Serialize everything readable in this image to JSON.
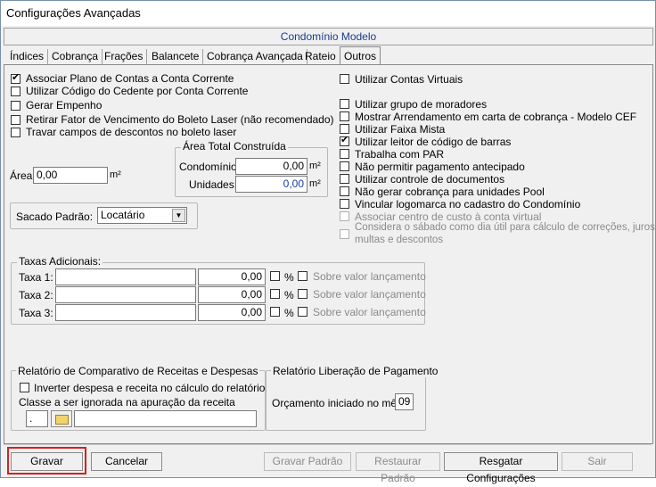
{
  "window": {
    "title": "Configurações Avançadas"
  },
  "header": {
    "title": "Condomínio Modelo"
  },
  "tabs": [
    "Índices",
    "Cobrança",
    "Frações",
    "Balancete",
    "Cobrança Avançada",
    "Rateio",
    "Outros"
  ],
  "active_tab": "Outros",
  "left_options": [
    {
      "label": "Associar Plano de Contas a Conta Corrente",
      "checked": true
    },
    {
      "label": "Utilizar Código do Cedente por Conta Corrente",
      "checked": false
    },
    {
      "label": "Gerar Empenho",
      "checked": false
    },
    {
      "label": "Retirar Fator de Vencimento do Boleto Laser (não recomendado)",
      "checked": false
    },
    {
      "label": "Travar campos de descontos no boleto laser",
      "checked": false
    }
  ],
  "area": {
    "label": "Área:",
    "value": "0,00",
    "unit": "m²"
  },
  "area_total": {
    "title": "Área Total Construída",
    "condominio_label": "Condomínio:",
    "condominio_value": "0,00",
    "unidades_label": "Unidades:",
    "unidades_value": "0,00",
    "unit": "m²"
  },
  "sacado": {
    "label": "Sacado Padrão:",
    "value": "Locatário"
  },
  "right_options": [
    {
      "label": "Utilizar Contas Virtuais",
      "checked": false,
      "disabled": false
    },
    {
      "label": "Utilizar grupo de moradores",
      "checked": false,
      "disabled": false
    },
    {
      "label": "Mostrar Arrendamento em carta de cobrança - Modelo CEF",
      "checked": false,
      "disabled": false
    },
    {
      "label": "Utilizar Faixa Mista",
      "checked": false,
      "disabled": false
    },
    {
      "label": "Utilizar leitor de código de barras",
      "checked": true,
      "disabled": false
    },
    {
      "label": "Trabalha com PAR",
      "checked": false,
      "disabled": false
    },
    {
      "label": "Não permitir pagamento antecipado",
      "checked": false,
      "disabled": false
    },
    {
      "label": "Utilizar controle de documentos",
      "checked": false,
      "disabled": false
    },
    {
      "label": "Não gerar cobrança para unidades Pool",
      "checked": false,
      "disabled": false
    },
    {
      "label": "Vincular logomarca no cadastro do Condomínio",
      "checked": false,
      "disabled": false
    },
    {
      "label": "Associar centro de custo à conta virtual",
      "checked": false,
      "disabled": true
    },
    {
      "label_line1": "Considera o sábado como dia útil para cálculo de correções, juros,",
      "label_line2": "multas e descontos",
      "checked": false,
      "disabled": true
    }
  ],
  "taxas": {
    "title": "Taxas Adicionais:",
    "rows": [
      {
        "label": "Taxa 1:",
        "name": "",
        "value": "0,00",
        "pct": "%",
        "sobre": "Sobre valor lançamento"
      },
      {
        "label": "Taxa 2:",
        "name": "",
        "value": "0,00",
        "pct": "%",
        "sobre": "Sobre valor lançamento"
      },
      {
        "label": "Taxa 3:",
        "name": "",
        "value": "0,00",
        "pct": "%",
        "sobre": "Sobre valor lançamento"
      }
    ]
  },
  "relatorio": {
    "title": "Relatório de Comparativo de Receitas e Despesas",
    "inverter_label": "Inverter despesa e receita no cálculo do relatório",
    "classe_label": "Classe a ser ignorada na apuração da receita",
    "classe_code": ".",
    "classe_desc": ""
  },
  "liberacao": {
    "title": "Relatório Liberação de Pagamento",
    "orcamento_label": "Orçamento iniciado no mês:",
    "orcamento_value": "09"
  },
  "buttons": {
    "gravar": "Gravar",
    "cancelar": "Cancelar",
    "gravar_padrao": "Gravar Padrão",
    "restaurar_padrao": "Restaurar Padrão",
    "resgatar": "Resgatar Configurações",
    "sair": "Sair"
  }
}
